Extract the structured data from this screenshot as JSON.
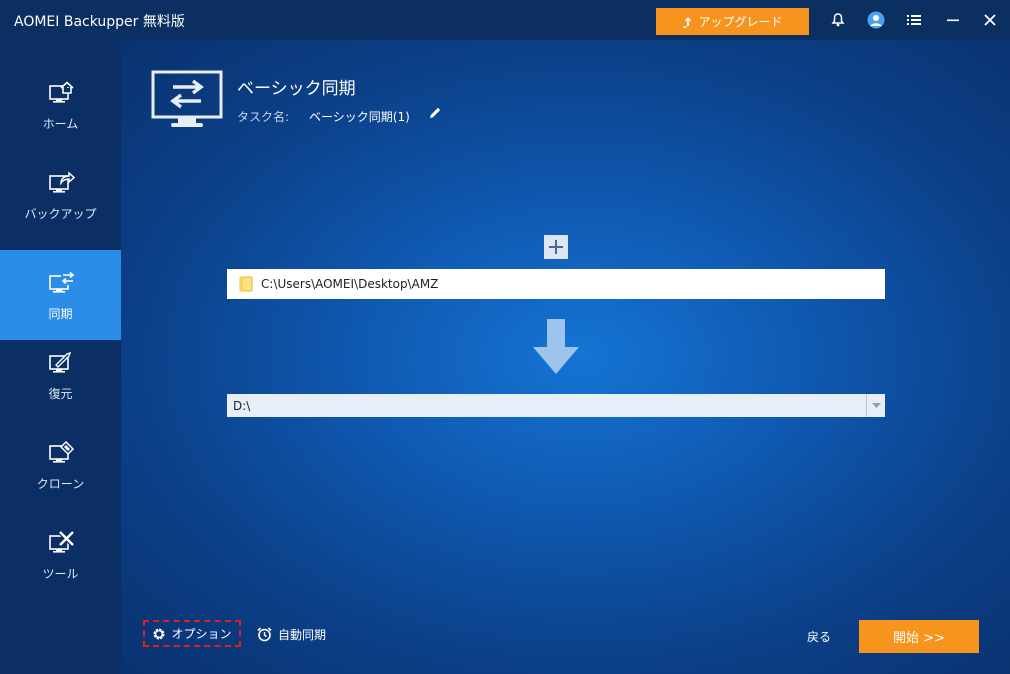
{
  "app": {
    "title": "AOMEI Backupper 無料版"
  },
  "titlebar": {
    "upgrade_label": "アップグレード"
  },
  "sidebar": {
    "items": [
      {
        "label": "ホーム",
        "icon": "home-icon"
      },
      {
        "label": "バックアップ",
        "icon": "backup-icon"
      },
      {
        "label": "同期",
        "icon": "sync-icon",
        "active": true
      },
      {
        "label": "復元",
        "icon": "restore-icon"
      },
      {
        "label": "クローン",
        "icon": "clone-icon"
      },
      {
        "label": "ツール",
        "icon": "tools-icon"
      }
    ]
  },
  "main": {
    "title": "ベーシック同期",
    "task_name_label": "タスク名:",
    "task_name_value": "ベーシック同期(1)",
    "source_path": "C:\\Users\\AOMEI\\Desktop\\AMZ",
    "destination": "D:\\",
    "options_label": "オプション",
    "schedule_label": "自動同期",
    "back_label": "戻る",
    "start_label": "開始 >>"
  },
  "colors": {
    "accent_orange": "#f7941d",
    "sidebar_active": "#2a8ee8",
    "sidebar_bg": "#0b2f64"
  }
}
